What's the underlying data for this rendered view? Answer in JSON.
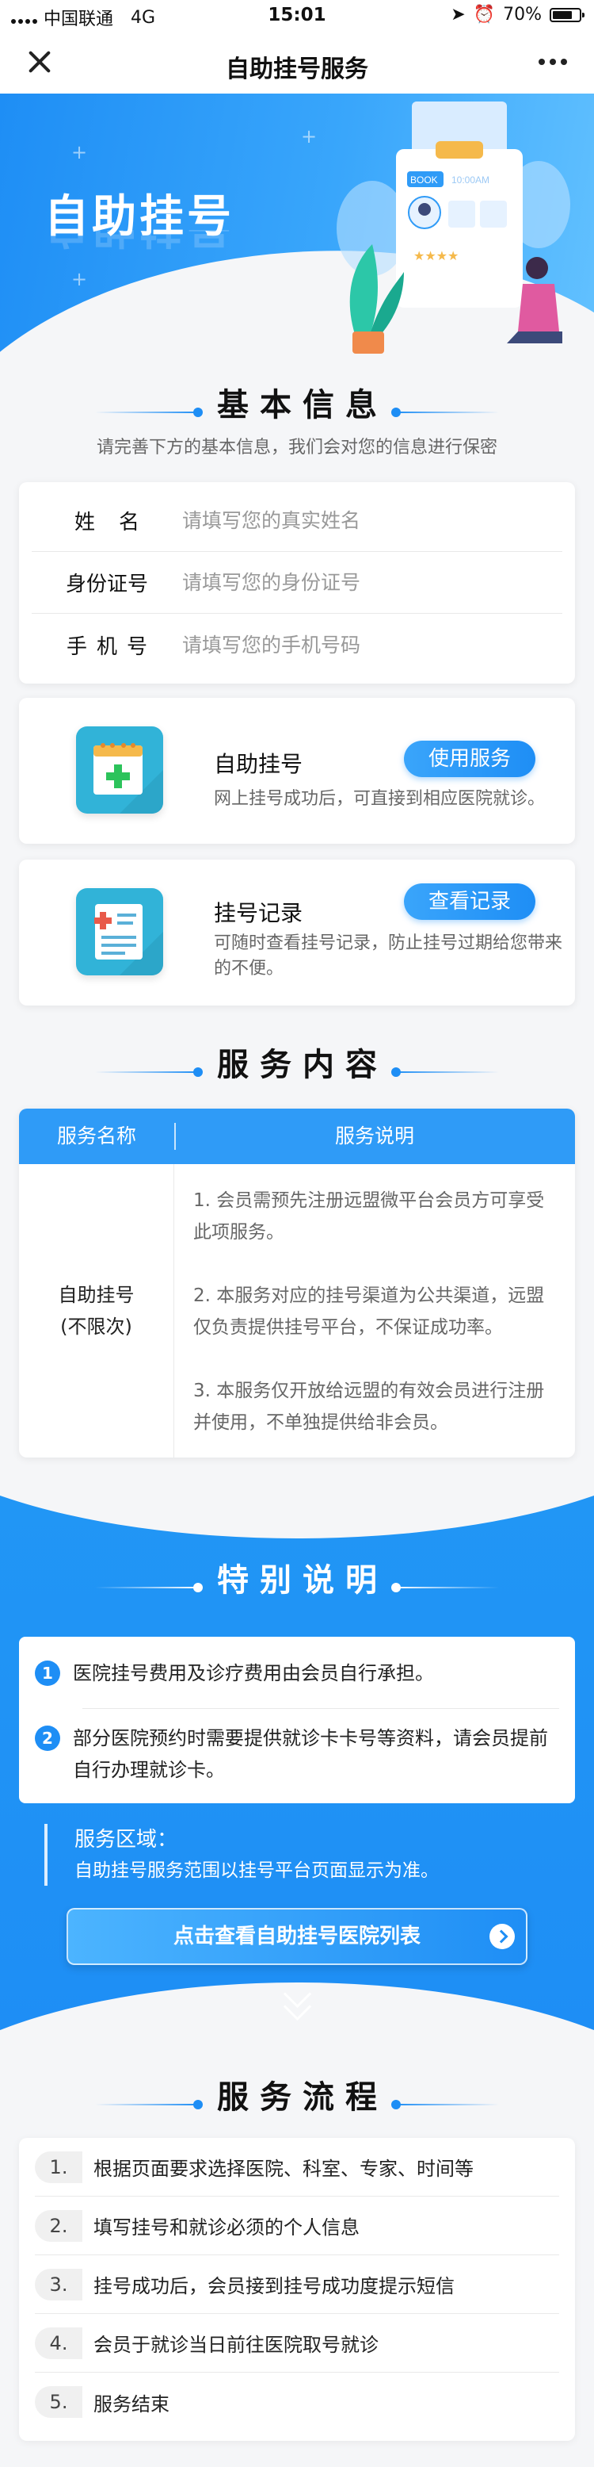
{
  "status_bar": {
    "carrier": "中国联通",
    "network": "4G",
    "time": "15:01",
    "battery": "70%"
  },
  "nav": {
    "title": "自助挂号服务"
  },
  "banner": {
    "title": "自助挂号",
    "illustration": {
      "book": "BOOK",
      "time": "10:00AM"
    }
  },
  "basic_info": {
    "title": "基本信息",
    "subtitle": "请完善下方的基本信息，我们会对您的信息进行保密",
    "fields": [
      {
        "label": "姓名",
        "placeholder": "请填写您的真实姓名",
        "value": ""
      },
      {
        "label": "身份证号",
        "placeholder": "请填写您的身份证号",
        "value": ""
      },
      {
        "label": "手机号",
        "placeholder": "请填写您的手机号码",
        "value": ""
      }
    ]
  },
  "services": [
    {
      "name": "自助挂号",
      "button": "使用服务",
      "desc": "网上挂号成功后，可直接到相应医院就诊。"
    },
    {
      "name": "挂号记录",
      "button": "查看记录",
      "desc": "可随时查看挂号记录，防止挂号过期给您带来的不便。"
    }
  ],
  "service_content": {
    "title": "服务内容",
    "headers": [
      "服务名称",
      "服务说明"
    ],
    "name_line1": "自助挂号",
    "name_line2": "(不限次)",
    "items": [
      "1. 会员需预先注册远盟微平台会员方可享受此项服务。",
      "2. 本服务对应的挂号渠道为公共渠道，远盟仅负责提供挂号平台，不保证成功率。",
      "3. 本服务仅开放给远盟的有效会员进行注册并使用，不单独提供给非会员。"
    ]
  },
  "special": {
    "title": "特别说明",
    "notes": [
      {
        "num": "1",
        "text": "医院挂号费用及诊疗费用由会员自行承担。"
      },
      {
        "num": "2",
        "text": "部分医院预约时需要提供就诊卡卡号等资料，请会员提前自行办理就诊卡。"
      }
    ],
    "area_title": "服务区域：",
    "area_desc": "自助挂号服务范围以挂号平台页面显示为准。",
    "list_button": "点击查看自助挂号医院列表"
  },
  "process": {
    "title": "服务流程",
    "steps": [
      {
        "no": "1.",
        "text": "根据页面要求选择医院、科室、专家、时间等"
      },
      {
        "no": "2.",
        "text": "填写挂号和就诊必须的个人信息"
      },
      {
        "no": "3.",
        "text": "挂号成功后，会员接到挂号成功度提示短信"
      },
      {
        "no": "4.",
        "text": "会员于就诊当日前往医院取号就诊"
      },
      {
        "no": "5.",
        "text": "服务结束"
      }
    ]
  }
}
